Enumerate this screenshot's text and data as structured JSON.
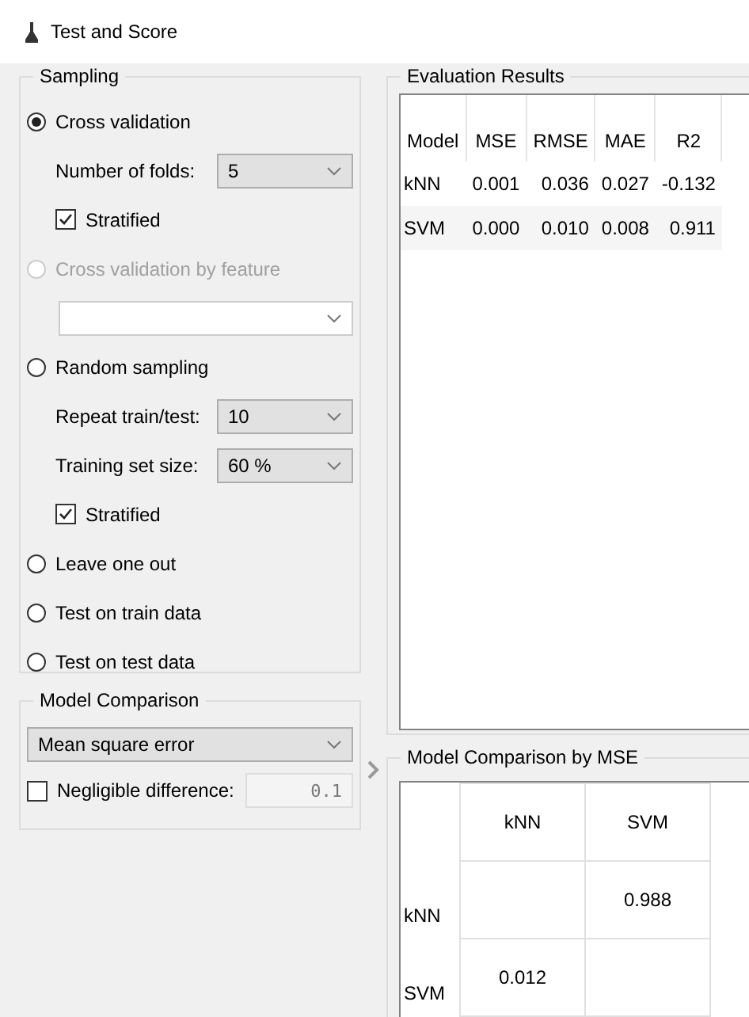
{
  "window": {
    "title": "Test and Score"
  },
  "sampling": {
    "title": "Sampling",
    "options": [
      {
        "kind": "radio",
        "label": "Cross validation",
        "selected": true,
        "disabled": false
      },
      {
        "kind": "combo",
        "label": "Number of folds:",
        "value": "5",
        "disabled": false
      },
      {
        "kind": "check",
        "label": "Stratified",
        "checked": true
      },
      {
        "kind": "radio",
        "label": "Cross validation by feature",
        "selected": false,
        "disabled": true
      },
      {
        "kind": "combo",
        "disabled": true
      },
      {
        "kind": "radio",
        "label": "Random sampling",
        "selected": false,
        "disabled": false
      },
      {
        "kind": "combo",
        "label": "Repeat train/test:",
        "value": "10",
        "disabled": false
      },
      {
        "kind": "combo",
        "label": "Training set size:",
        "value": "60 %",
        "disabled": false
      },
      {
        "kind": "check",
        "label": "Stratified",
        "checked": true
      },
      {
        "kind": "radio",
        "label": "Leave one out",
        "selected": false,
        "disabled": false
      },
      {
        "kind": "radio",
        "label": "Test on train data",
        "selected": false,
        "disabled": false
      },
      {
        "kind": "radio",
        "label": "Test on test data",
        "selected": false,
        "disabled": false
      }
    ]
  },
  "model_comparison": {
    "title": "Model Comparison",
    "score": "Mean square error",
    "negligible": {
      "label": "Negligible difference:",
      "checked": false,
      "value": "0.1"
    }
  },
  "evaluation_results": {
    "title": "Evaluation Results",
    "columns": [
      "Model",
      "MSE",
      "RMSE",
      "MAE",
      "R2"
    ],
    "rows": [
      {
        "cells": [
          "kNN",
          "0.001",
          "0.036",
          "0.027",
          "-0.132"
        ]
      },
      {
        "cells": [
          "SVM",
          "0.000",
          "0.010",
          "0.008",
          "0.911"
        ]
      }
    ]
  },
  "comparison": {
    "title": "Model Comparison by MSE",
    "columns": [
      "kNN",
      "SVM"
    ],
    "rows": [
      {
        "header": "kNN",
        "cells": [
          null,
          "0.988"
        ]
      },
      {
        "header": "SVM",
        "cells": [
          "0.012",
          null
        ]
      }
    ]
  }
}
